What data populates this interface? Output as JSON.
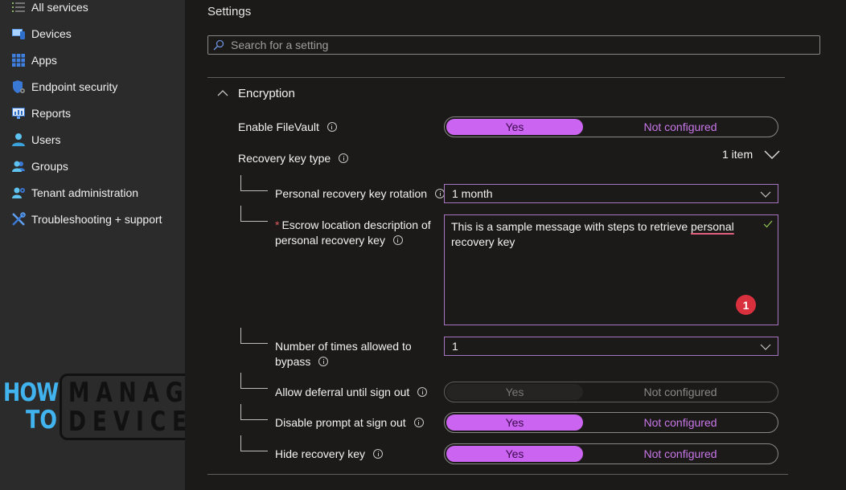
{
  "sidebar": {
    "items": [
      {
        "label": "All services",
        "icon": "list-icon"
      },
      {
        "label": "Devices",
        "icon": "devices-icon"
      },
      {
        "label": "Apps",
        "icon": "apps-grid-icon"
      },
      {
        "label": "Endpoint security",
        "icon": "shield-gear-icon"
      },
      {
        "label": "Reports",
        "icon": "monitor-chart-icon"
      },
      {
        "label": "Users",
        "icon": "user-icon"
      },
      {
        "label": "Groups",
        "icon": "group-icon"
      },
      {
        "label": "Tenant administration",
        "icon": "tenant-admin-icon"
      },
      {
        "label": "Troubleshooting + support",
        "icon": "wrench-screwdriver-icon"
      }
    ]
  },
  "watermark": {
    "how": "HOW",
    "to": "TO",
    "manage": "MANAGE",
    "devices": "DEVICES"
  },
  "settings": {
    "title": "Settings",
    "search_placeholder": "Search for a setting",
    "section": "Encryption",
    "enable_filevault": {
      "label": "Enable FileVault",
      "options": [
        "Yes",
        "Not configured"
      ],
      "selected": "Yes"
    },
    "recovery_key_type": {
      "label": "Recovery key type",
      "count": "1 item"
    },
    "rotation": {
      "label": "Personal recovery key rotation",
      "value": "1 month"
    },
    "escrow": {
      "required_mark": "*",
      "label": "Escrow location description of personal recovery key",
      "value_before": "This is a sample message with steps to retrieve ",
      "value_misspelled": "personal",
      "value_after": " recovery key",
      "badge": "1"
    },
    "bypass": {
      "label": "Number of times allowed to bypass",
      "value": "1"
    },
    "allow_deferral": {
      "label": "Allow deferral until sign out",
      "options": [
        "Yes",
        "Not configured"
      ],
      "selected": "none"
    },
    "disable_prompt": {
      "label": "Disable prompt at sign out",
      "options": [
        "Yes",
        "Not configured"
      ],
      "selected": "Yes"
    },
    "hide_recovery": {
      "label": "Hide recovery key",
      "options": [
        "Yes",
        "Not configured"
      ],
      "selected": "Yes"
    }
  },
  "colors": {
    "accent": "#cb64f0",
    "field_border": "#a675c2",
    "badge": "#d8303d",
    "logo_blue": "#41b4f0"
  }
}
